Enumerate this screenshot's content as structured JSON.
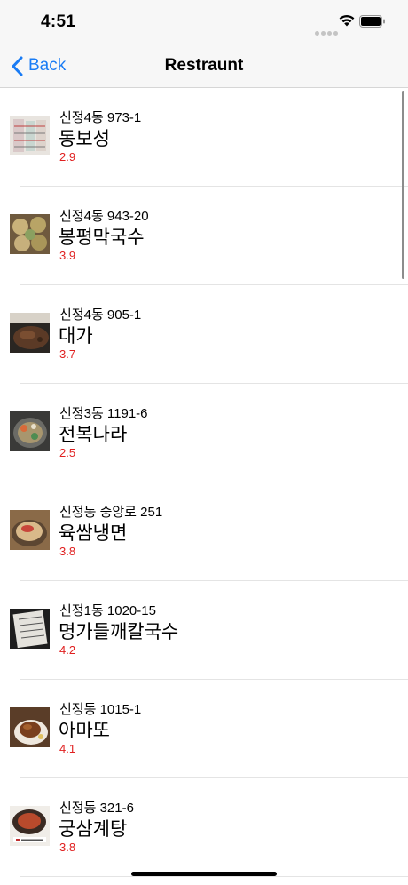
{
  "status_bar": {
    "time": "4:51",
    "wifi_icon": "wifi-icon",
    "battery_icon": "battery-icon"
  },
  "nav": {
    "back_label": "Back",
    "title": "Restraunt",
    "back_icon": "chevron-left-icon"
  },
  "rating_color": "#e02020",
  "accent_color": "#1a7cf5",
  "restaurants": [
    {
      "address": "신정4동 973-1",
      "name": "동보성",
      "rating": "2.9"
    },
    {
      "address": "신정4동 943-20",
      "name": "봉평막국수",
      "rating": "3.9"
    },
    {
      "address": "신정4동 905-1",
      "name": "대가",
      "rating": "3.7"
    },
    {
      "address": "신정3동 1191-6",
      "name": "전복나라",
      "rating": "2.5"
    },
    {
      "address": "신정동 중앙로 251",
      "name": "육쌈냉면",
      "rating": "3.8"
    },
    {
      "address": "신정1동 1020-15",
      "name": "명가들깨칼국수",
      "rating": "4.2"
    },
    {
      "address": "신정동 1015-1",
      "name": "아마또",
      "rating": "4.1"
    },
    {
      "address": "신정동 321-6",
      "name": "궁삼계탕",
      "rating": "3.8"
    }
  ]
}
